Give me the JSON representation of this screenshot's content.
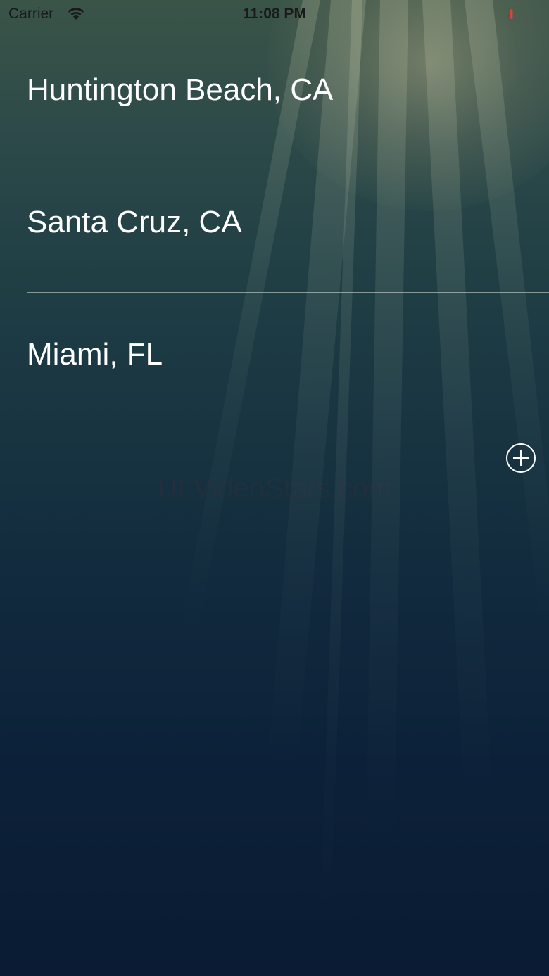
{
  "status_bar": {
    "carrier": "Carrier",
    "time": "11:08 PM",
    "battery_level_percent": 10,
    "wifi_icon": "wifi-icon",
    "battery_icon": "battery-icon"
  },
  "locations": [
    {
      "name": "Huntington Beach, CA"
    },
    {
      "name": "Santa Cruz, CA"
    },
    {
      "name": "Miami, FL"
    }
  ],
  "add_button": {
    "icon": "plus-circle-icon"
  },
  "watermark": {
    "text": "UI.VideoStars.com"
  },
  "colors": {
    "text": "#ffffff",
    "divider": "#dce6e1",
    "battery_low": "#e0403a",
    "background_top": "#3a5448",
    "background_bottom": "#0a1b33"
  }
}
